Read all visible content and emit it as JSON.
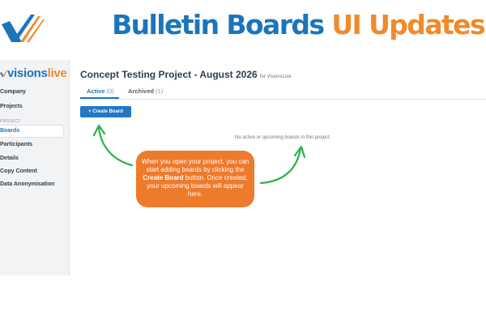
{
  "banner": {
    "title_part1": "Bulletin Boards",
    "title_part2": "UI Updates"
  },
  "sidebar": {
    "brand_part1": "visions",
    "brand_part2": "live",
    "section_label": "PROJECT",
    "items": [
      {
        "label": "Company"
      },
      {
        "label": "Projects"
      },
      {
        "label": "Boards"
      },
      {
        "label": "Participants"
      },
      {
        "label": "Details"
      },
      {
        "label": "Copy Content"
      },
      {
        "label": "Data Anonymisation"
      }
    ]
  },
  "main": {
    "title": "Concept Testing Project - August 2026",
    "subtitle": "for VisionsLive",
    "tabs": [
      {
        "label": "Active",
        "count": "(0)"
      },
      {
        "label": "Archived",
        "count": "(1)"
      }
    ],
    "create_button": "+ Create Board",
    "empty_message": "No active or upcoming boards in this project."
  },
  "callout": {
    "text_before": "When you open your project, you can start adding boards by clicking the ",
    "text_bold": "Create Board",
    "text_after": " button. Once created, your upcoming boards will appear here."
  },
  "colors": {
    "brand_blue": "#1b75bb",
    "brand_orange": "#f18a2b",
    "callout_orange": "#ee7a2c",
    "arrow_green": "#2db34a",
    "button_blue": "#2178c4"
  }
}
